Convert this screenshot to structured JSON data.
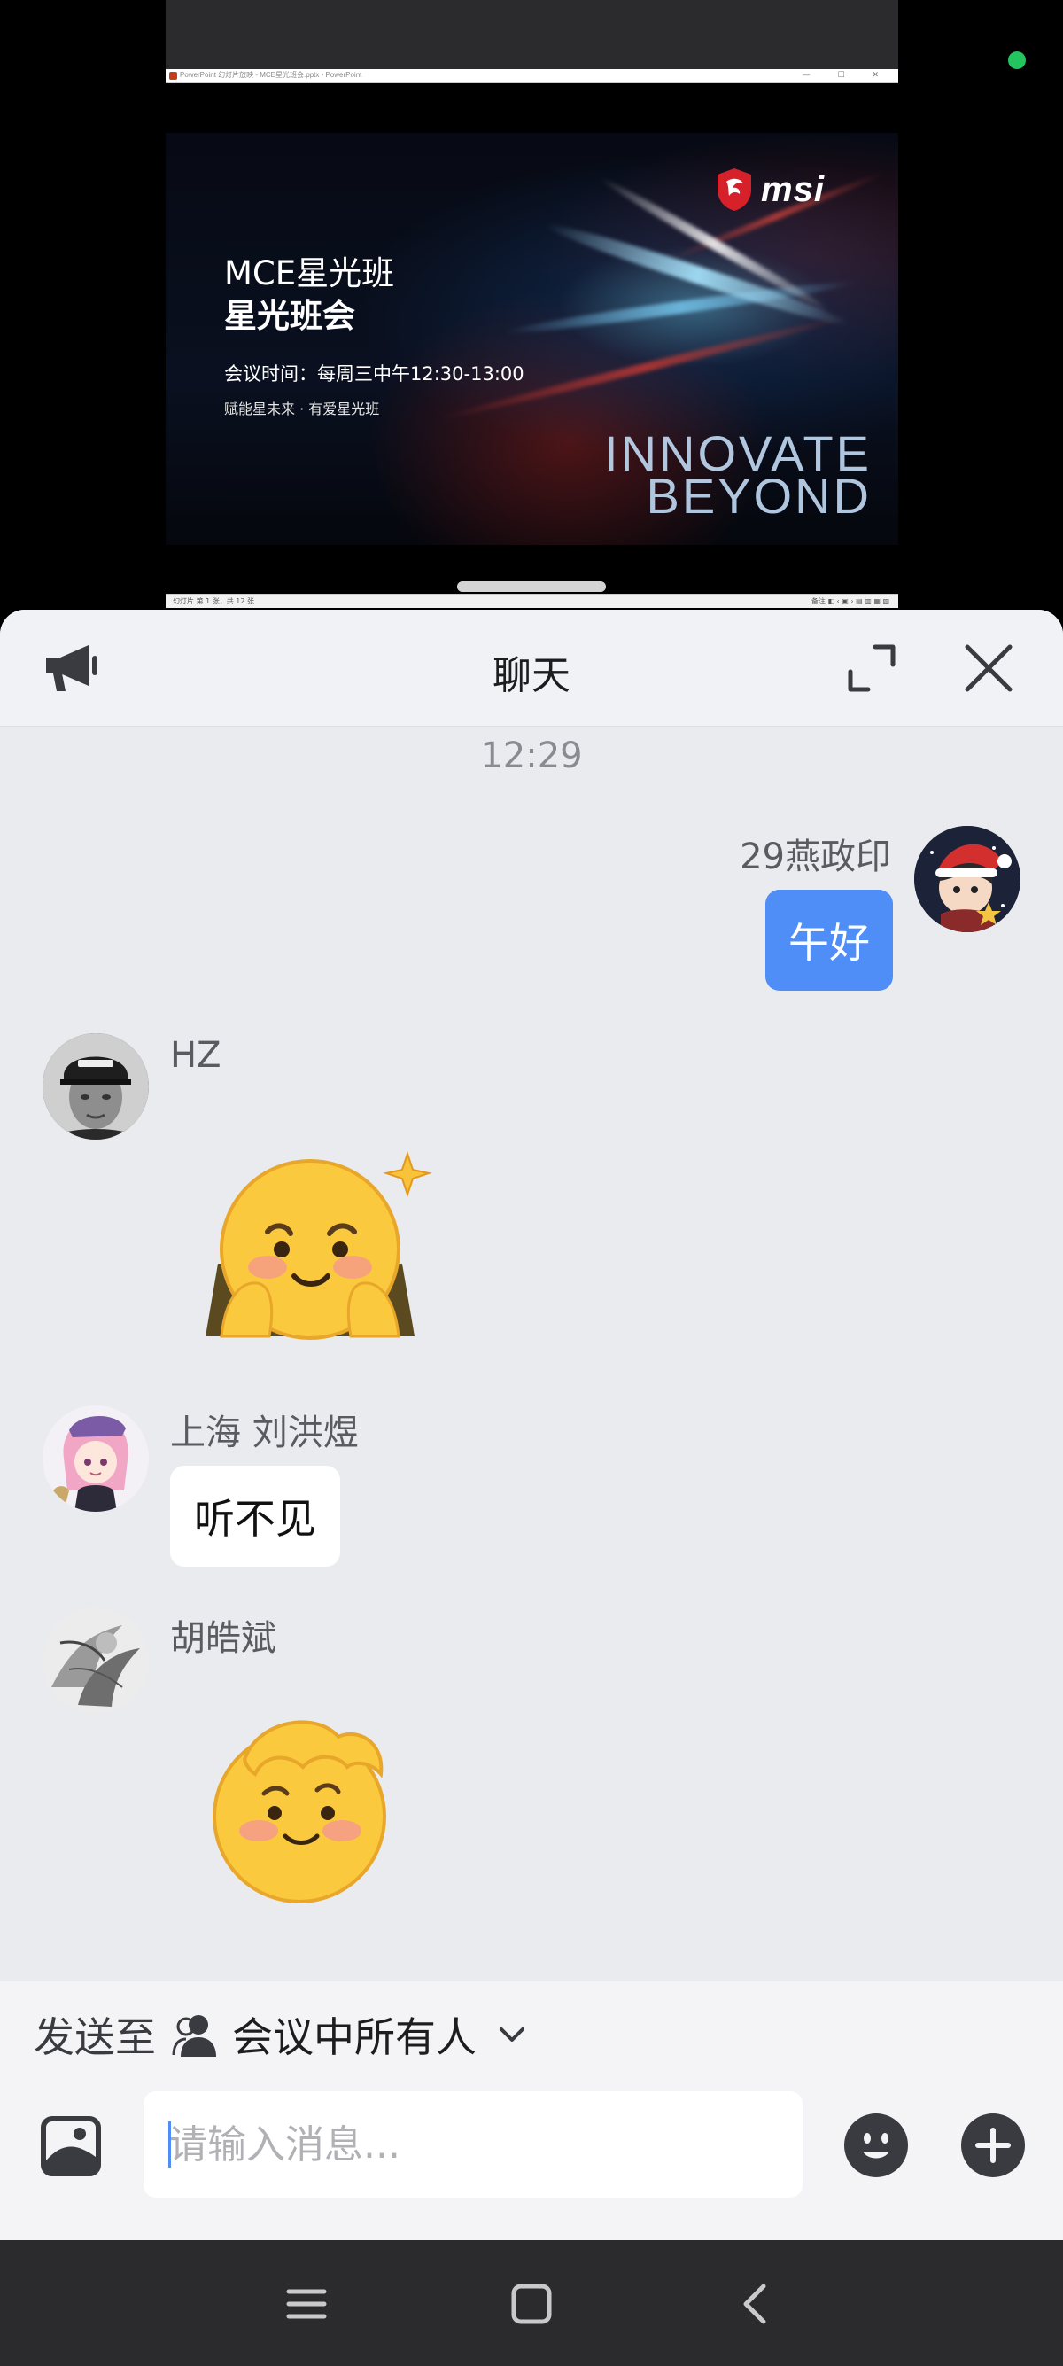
{
  "screen_share": {
    "window_title": "PowerPoint 幻灯片放映 - MCE星光班会.pptx - PowerPoint",
    "window_controls": "— ☐ ✕",
    "slide": {
      "brand": "msi",
      "title_line1": "MCE星光班",
      "title_line2": "星光班会",
      "meeting_time": "会议时间：每周三中午12:30-13:00",
      "slogan": "赋能星未来 · 有爱星光班",
      "tagline_line1": "INNOVATE",
      "tagline_line2": "BEYOND"
    },
    "status_left": "幻灯片 第 1 张，共 12 张",
    "status_right": "备注  ◧  ‹  ▣  ›  ▤  ▥  ▦  ▧"
  },
  "chat": {
    "header": {
      "title": "聊天",
      "left_icon": "announcement-icon",
      "expand_icon": "expand-icon",
      "close_icon": "close-icon"
    },
    "time_divider": "12:29",
    "messages": [
      {
        "sender": "29燕政印",
        "mine": true,
        "type": "text",
        "text": "午好"
      },
      {
        "sender": "HZ",
        "mine": false,
        "type": "sticker",
        "sticker": "shy-face-sticker"
      },
      {
        "sender": "上海 刘洪煜",
        "mine": false,
        "type": "text",
        "text": "听不见"
      },
      {
        "sender": "胡皓斌",
        "mine": false,
        "type": "sticker",
        "sticker": "head-pat-sticker"
      }
    ]
  },
  "compose": {
    "send_to_prefix": "发送至",
    "send_to_target": "会议中所有人",
    "input_placeholder": "请输入消息...",
    "input_value": ""
  },
  "colors": {
    "accent_blue": "#4f8df7",
    "chat_background": "#eaebef",
    "status_dot": "#22c55e"
  }
}
